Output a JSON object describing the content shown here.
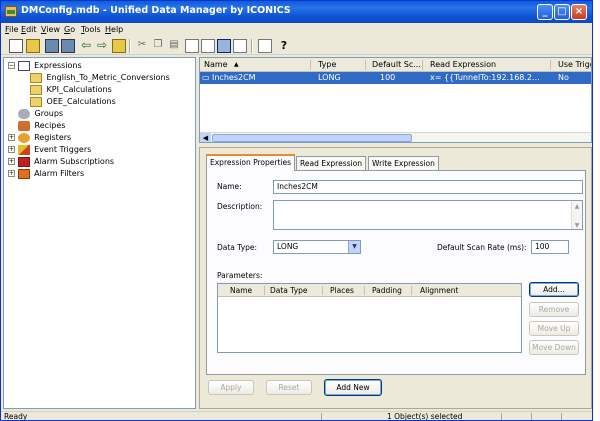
{
  "window": {
    "title": "DMConfig.mdb - Unified Data Manager by ICONICS"
  },
  "menu": [
    "File",
    "Edit",
    "View",
    "Go",
    "Tools",
    "Help"
  ],
  "toolbar": {
    "help_glyph": "?"
  },
  "tree": {
    "expressions": "Expressions",
    "english": "English_To_Metric_Conversions",
    "kpi": "KPI_Calculations",
    "oee": "OEE_Calculations",
    "groups": "Groups",
    "recipes": "Recipes",
    "registers": "Registers",
    "triggers": "Event Triggers",
    "alarm_subs": "Alarm Subscriptions",
    "alarm_filters": "Alarm Filters",
    "expand_glyph": "+",
    "collapse_glyph": "−"
  },
  "list": {
    "columns": [
      "Name",
      "Type",
      "Default Sc...",
      "Read Expression",
      "Use Trigg"
    ],
    "sort_glyph": "▲",
    "rows": [
      {
        "name": "Inches2CM",
        "type": "LONG",
        "default_scan": "100",
        "read_expression": "x= {{TunnelTo:192.168.2...",
        "use_trigger": "No"
      }
    ],
    "scroll_left_glyph": "◀"
  },
  "panel": {
    "tabs": [
      "Expression Properties",
      "Read Expression",
      "Write Expression"
    ],
    "name_label": "Name:",
    "name_value": "Inches2CM",
    "description_label": "Description:",
    "description_value": "",
    "data_type_label": "Data Type:",
    "data_type_value": "LONG",
    "scan_rate_label": "Default Scan Rate (ms):",
    "scan_rate_value": "100",
    "parameters_label": "Parameters:",
    "param_columns": [
      "Name",
      "Data Type",
      "Places",
      "Padding",
      "Alignment"
    ],
    "buttons": {
      "add": "Add...",
      "remove": "Remove",
      "move_up": "Move Up",
      "move_down": "Move Down"
    },
    "scroll_up_glyph": "▲",
    "scroll_down_glyph": "▼",
    "combo_glyph": "▼"
  },
  "actions": {
    "apply": "Apply",
    "reset": "Reset",
    "add_new": "Add New"
  },
  "status": {
    "left": "Ready",
    "center": "1 Object(s) selected"
  }
}
